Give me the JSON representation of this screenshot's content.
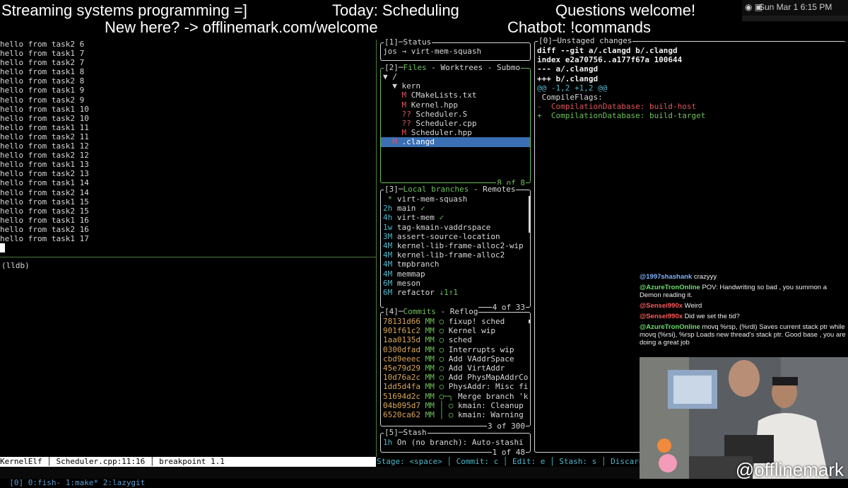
{
  "banner": {
    "title": "Streaming systems programming =]",
    "topic": "Today: Scheduling",
    "questions": "Questions welcome!",
    "newhere": "New here? -> offlinemark.com/welcome",
    "chatbot": "Chatbot: !commands"
  },
  "menubar": {
    "datetime": "Sun Mar 1  6:15 PM"
  },
  "terminal": {
    "lines": [
      "hello from task2 6",
      "hello from task1 7",
      "hello from task2 7",
      "hello from task1 8",
      "hello from task2 8",
      "hello from task1 9",
      "hello from task2 9",
      "hello from task1 10",
      "hello from task2 10",
      "hello from task1 11",
      "hello from task2 11",
      "hello from task1 12",
      "hello from task2 12",
      "hello from task1 13",
      "hello from task2 13",
      "hello from task1 14",
      "hello from task2 14",
      "hello from task1 15",
      "hello from task2 15",
      "hello from task1 16",
      "hello from task2 16",
      "hello from task1 17"
    ],
    "lldb_prompt": "(lldb)"
  },
  "vim_status": "KernelElf │ Scheduler.cpp:11:16 │ breakpoint 1.1",
  "tmux": {
    "windows": "[0] 0:fish- 1:make* 2:lazygit"
  },
  "lazygit": {
    "status": {
      "title": "[1]─Status",
      "repo": "jos → virt-mem-squash"
    },
    "files": {
      "title_num": "[2]─",
      "title_active": "Files",
      "title_rest": " - Worktrees - Submo",
      "footer": "8 of 8",
      "items": [
        {
          "status": "",
          "indent": 0,
          "name": "▼ /",
          "color": ""
        },
        {
          "status": "",
          "indent": 1,
          "name": "▼ kern",
          "color": ""
        },
        {
          "status": "M",
          "indent": 2,
          "name": "CMakeLists.txt",
          "color": "red"
        },
        {
          "status": "M",
          "indent": 2,
          "name": "Kernel.hpp",
          "color": "red"
        },
        {
          "status": "??",
          "indent": 2,
          "name": "Scheduler.S",
          "color": "red"
        },
        {
          "status": "??",
          "indent": 2,
          "name": "Scheduler.cpp",
          "color": "red"
        },
        {
          "status": "M",
          "indent": 2,
          "name": "Scheduler.hpp",
          "color": "red"
        },
        {
          "status": "M",
          "indent": 1,
          "name": ".clangd",
          "color": "red",
          "selected": true
        }
      ]
    },
    "branches": {
      "title_num": "[3]─",
      "title_active": "Local branches",
      "title_rest": " - Remotes",
      "footer": "4 of 33",
      "items": [
        {
          "age": " *",
          "name": "virt-mem-squash",
          "suffix": ""
        },
        {
          "age": "2h",
          "name": "main",
          "suffix": " ✓"
        },
        {
          "age": "4h",
          "name": "virt-mem",
          "suffix": " ✓"
        },
        {
          "age": "1w",
          "name": "tag-kmain-vaddrspace",
          "suffix": ""
        },
        {
          "age": "3M",
          "name": "assert-source-location",
          "suffix": ""
        },
        {
          "age": "4M",
          "name": "kernel-lib-frame-alloc2-wip",
          "suffix": ""
        },
        {
          "age": "4M",
          "name": "kernel-lib-frame-alloc2",
          "suffix": ""
        },
        {
          "age": "4M",
          "name": "tmpbranch",
          "suffix": ""
        },
        {
          "age": "4M",
          "name": "memmap",
          "suffix": ""
        },
        {
          "age": "6M",
          "name": "meson",
          "suffix": ""
        },
        {
          "age": "6M",
          "name": "refactor",
          "suffix": " ↓1↑1"
        }
      ]
    },
    "commits": {
      "title_num": "[4]─",
      "title_active": "Commits",
      "title_rest": " - Reflog",
      "footer": "3 of 300",
      "items": [
        {
          "hash": "78131d66",
          "graph": "MM ○",
          "msg": "fixup! sched"
        },
        {
          "hash": "901f61c2",
          "graph": "MM ○",
          "msg": "Kernel wip"
        },
        {
          "hash": "1aa0135d",
          "graph": "MM ○",
          "msg": "sched"
        },
        {
          "hash": "0300dfad",
          "graph": "MM ○",
          "msg": "Interrupts wip"
        },
        {
          "hash": "cbd9eeec",
          "graph": "MM ○",
          "msg": "Add VAddrSpace"
        },
        {
          "hash": "45e79d29",
          "graph": "MM ○",
          "msg": "Add VirtAddr"
        },
        {
          "hash": "10d76a2c",
          "graph": "MM ○",
          "msg": "Add PhysMapAddrCo"
        },
        {
          "hash": "1dd5d4fa",
          "graph": "MM ○",
          "msg": "PhysAddr: Misc fi"
        },
        {
          "hash": "51694d2c",
          "graph": "MM ○─╮",
          "msg": "Merge branch 'k"
        },
        {
          "hash": "04b095d7",
          "graph": "MM │ ○",
          "msg": "kmain: Cleanup"
        },
        {
          "hash": "6520ca62",
          "graph": "MM │ ○",
          "msg": "kmain: Warning"
        }
      ]
    },
    "stash": {
      "title": "[5]─Stash",
      "footer": "1 of 48",
      "items": [
        {
          "age": "1h",
          "msg": "On (no branch): Auto-stashi"
        }
      ]
    },
    "diff": {
      "title": "[0]─Unstaged changes",
      "lines": [
        {
          "text": "diff --git a/.clangd b/.clangd",
          "color": "bold"
        },
        {
          "text": "index e2a70756..a177f67a 100644",
          "color": "bold"
        },
        {
          "text": "--- a/.clangd",
          "color": "bold"
        },
        {
          "text": "+++ b/.clangd",
          "color": "bold"
        },
        {
          "text": "@@ -1,2 +1,2 @@",
          "color": "cyan"
        },
        {
          "text": " CompileFlags:",
          "color": ""
        },
        {
          "text": "-  CompilationDatabase: build-host",
          "color": "red"
        },
        {
          "text": "+  CompilationDatabase: build-target",
          "color": "green"
        }
      ]
    },
    "keybar": "Stage: <space> │ Commit: c │ Edit: e │ Stash: s │ Discard"
  },
  "chat": [
    {
      "user": "@1997shashank",
      "color": "#7fb2ff",
      "text": "crazyyy"
    },
    {
      "user": "@AzureTronOnline",
      "color": "#6ee06e",
      "text": "POV: Handwriting so bad , you summon a Demon reading it."
    },
    {
      "user": "@Sensei990x",
      "color": "#ff5a5a",
      "text": "Weird"
    },
    {
      "user": "@Sensei990x",
      "color": "#ff5a5a",
      "text": "Did we set the tid?"
    },
    {
      "user": "@AzureTronOnline",
      "color": "#6ee06e",
      "text": "movq %rsp, (%rdi) Saves current stack ptr while movq (%rsi), %rsp Loads new thread's stack ptr. Good base , you are doing a great job"
    }
  ],
  "webcam": {
    "handle": "@offlinemark"
  },
  "colors": {
    "accent_green": "#6ec05a",
    "selection_blue": "#3a6fb4",
    "diff_red": "#e0555a"
  }
}
